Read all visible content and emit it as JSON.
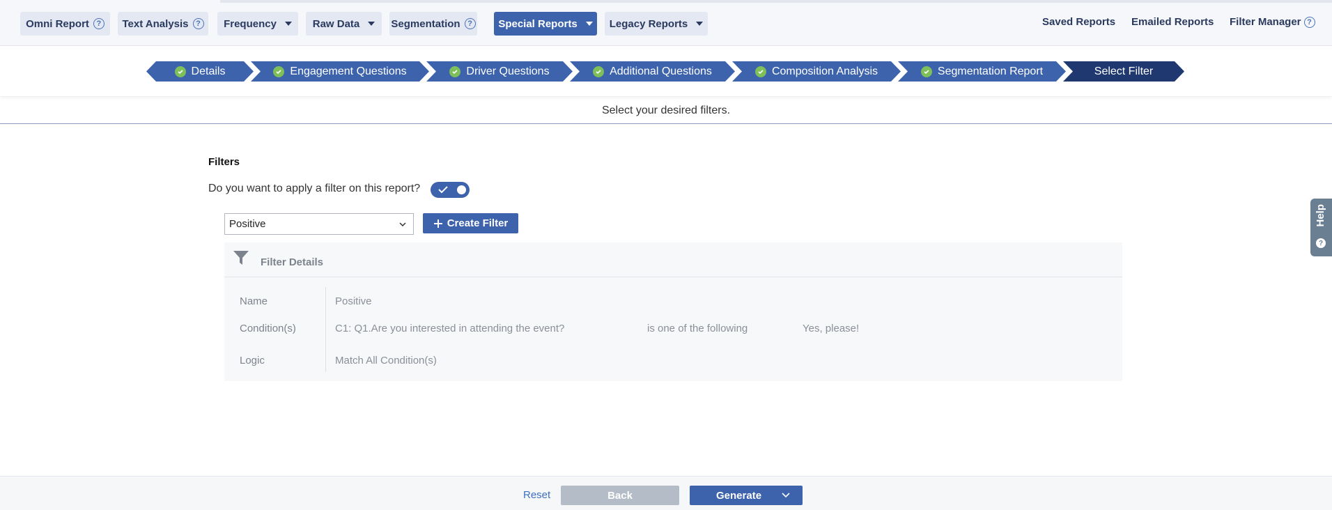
{
  "nav": {
    "left": [
      {
        "label": "Omni Report",
        "help": true,
        "caret": false,
        "active": false
      },
      {
        "label": "Text Analysis",
        "help": true,
        "caret": false,
        "active": false
      },
      {
        "label": "Frequency",
        "help": false,
        "caret": true,
        "active": false
      },
      {
        "label": "Raw Data",
        "help": false,
        "caret": true,
        "active": false
      },
      {
        "label": "Segmentation",
        "help": true,
        "caret": false,
        "active": false
      },
      {
        "label": "Special Reports",
        "help": false,
        "caret": true,
        "active": true
      },
      {
        "label": "Legacy Reports",
        "help": false,
        "caret": true,
        "active": false
      }
    ],
    "right": {
      "saved": "Saved Reports",
      "emailed": "Emailed Reports",
      "filter_manager": "Filter Manager"
    },
    "help_glyph": "?"
  },
  "wizard": {
    "steps": [
      {
        "label": "Details",
        "done": true
      },
      {
        "label": "Engagement Questions",
        "done": true
      },
      {
        "label": "Driver Questions",
        "done": true
      },
      {
        "label": "Additional Questions",
        "done": true
      },
      {
        "label": "Composition Analysis",
        "done": true
      },
      {
        "label": "Segmentation Report",
        "done": true
      },
      {
        "label": "Select Filter",
        "done": false,
        "current": true
      }
    ]
  },
  "subtitle": "Select your desired filters.",
  "filters": {
    "section_title": "Filters",
    "question": "Do you want to apply a filter on this report?",
    "toggle_on": true,
    "selected_filter": "Positive",
    "create_label": "Create Filter"
  },
  "details": {
    "title": "Filter Details",
    "name_label": "Name",
    "name_value": "Positive",
    "conditions_label": "Condition(s)",
    "condition": {
      "question": "C1: Q1.Are you interested in attending the event?",
      "operator": "is one of the following",
      "value": "Yes, please!"
    },
    "logic_label": "Logic",
    "logic_value": "Match All Condition(s)"
  },
  "help_tab": {
    "label": "Help",
    "glyph": "?"
  },
  "footer": {
    "reset": "Reset",
    "back": "Back",
    "generate": "Generate"
  },
  "colors": {
    "primary": "#3d63ac",
    "dark_step": "#1f3970",
    "check_green": "#7fbf5a"
  }
}
